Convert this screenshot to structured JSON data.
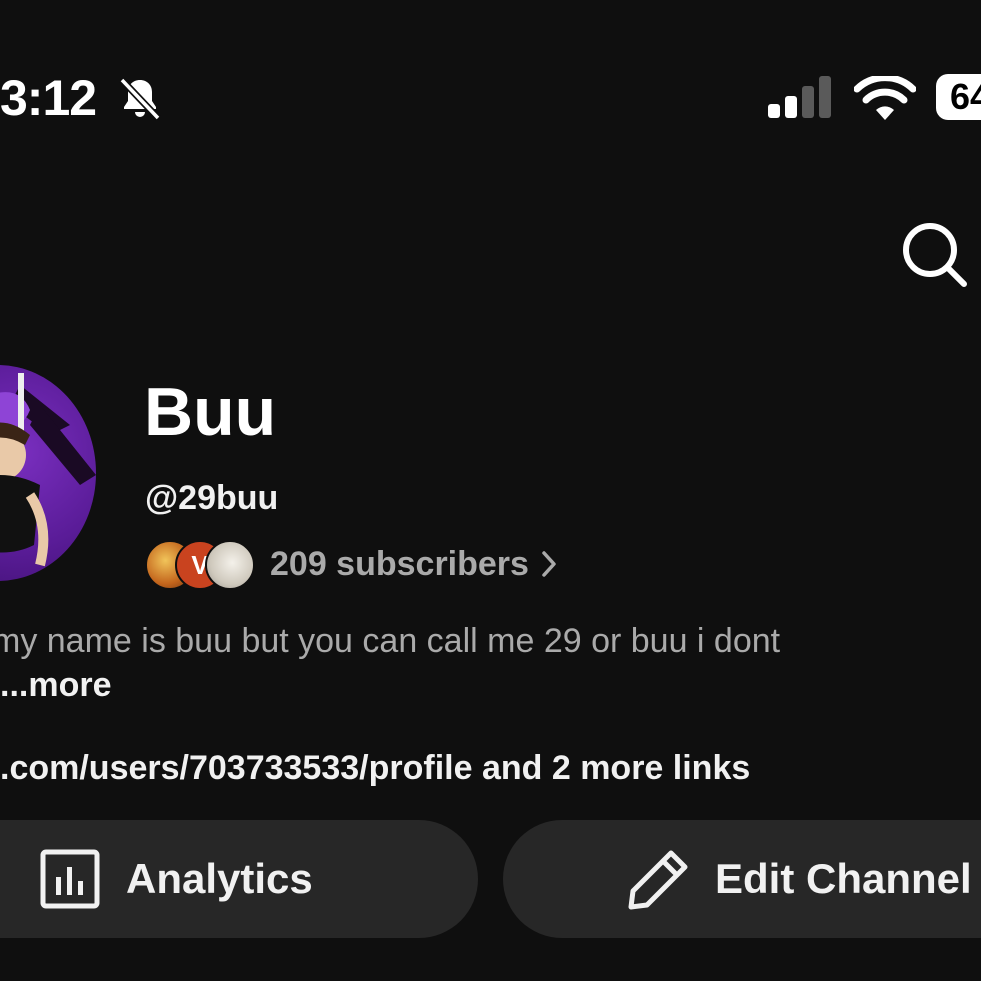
{
  "status_bar": {
    "time": "3:12",
    "battery": "64",
    "mute_icon": "bell-slash-icon",
    "signal_icon": "cellular-signal-icon",
    "wifi_icon": "wifi-icon"
  },
  "header": {
    "search_icon": "search-icon"
  },
  "channel": {
    "name": "Buu",
    "handle": "@29buu",
    "subscribers": "209 subscribers",
    "sub_avatar_2_letter": "V",
    "description": "my name is buu but you can call me 29 or buu i dont",
    "more_label": "...more",
    "links_text": ".com/users/703733533/profile and 2 more links"
  },
  "actions": {
    "analytics_label": "Analytics",
    "analytics_icon": "bar-chart-icon",
    "edit_label": "Edit Channel",
    "edit_icon": "pencil-icon"
  },
  "colors": {
    "background": "#0f0f0f",
    "button_bg": "#272727",
    "secondary_text": "#aaaaaa",
    "avatar_purple": "#6a24b0"
  }
}
